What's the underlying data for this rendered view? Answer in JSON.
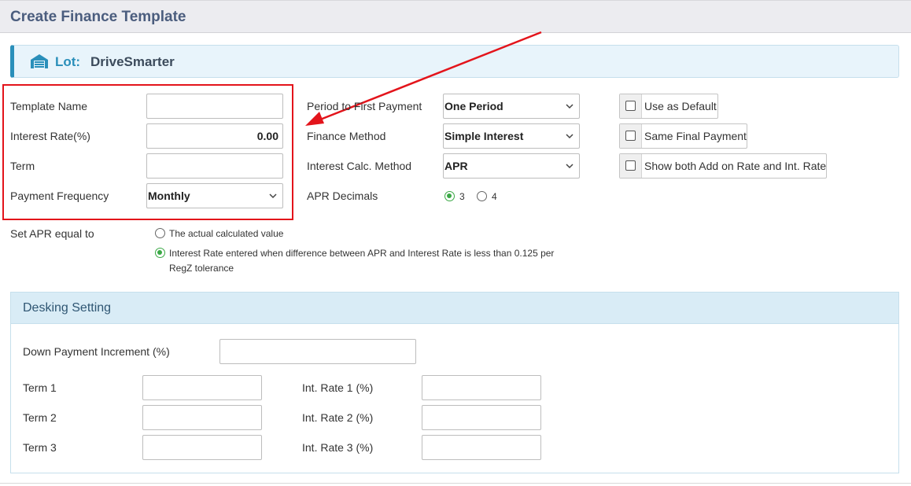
{
  "header": {
    "title": "Create Finance Template"
  },
  "lot": {
    "icon": "garage-icon",
    "label": "Lot:",
    "value": "DriveSmarter"
  },
  "left_fields": {
    "template_name": {
      "label": "Template Name",
      "value": ""
    },
    "interest_rate": {
      "label": "Interest Rate(%)",
      "value": "0.00"
    },
    "term": {
      "label": "Term",
      "value": ""
    },
    "payment_frequency": {
      "label": "Payment Frequency",
      "value": "Monthly"
    }
  },
  "middle_fields": {
    "period_first_payment": {
      "label": "Period to First Payment",
      "value": "One Period"
    },
    "finance_method": {
      "label": "Finance Method",
      "value": "Simple Interest"
    },
    "interest_calc_method": {
      "label": "Interest Calc. Method",
      "value": "APR"
    },
    "apr_decimals": {
      "label": "APR Decimals",
      "options": [
        "3",
        "4"
      ],
      "selected": "3"
    }
  },
  "checkboxes": {
    "use_default": {
      "label": "Use as Default",
      "checked": false
    },
    "same_final": {
      "label": "Same Final Payment",
      "checked": false
    },
    "show_both": {
      "label": "Show both Add on Rate and Int. Rate",
      "checked": false
    }
  },
  "set_apr": {
    "label": "Set APR equal to",
    "option1": "The actual calculated value",
    "option2_line1": "Interest Rate entered when difference between APR and Interest Rate is less than 0.125 per",
    "option2_line2": "RegZ tolerance",
    "selected": 2
  },
  "desking": {
    "title": "Desking Setting",
    "down_payment": {
      "label": "Down Payment Increment (%)",
      "value": ""
    },
    "terms": [
      {
        "label": "Term 1",
        "value": ""
      },
      {
        "label": "Term 2",
        "value": ""
      },
      {
        "label": "Term 3",
        "value": ""
      }
    ],
    "rates": [
      {
        "label": "Int. Rate 1 (%)",
        "value": ""
      },
      {
        "label": "Int. Rate 2 (%)",
        "value": ""
      },
      {
        "label": "Int. Rate 3 (%)",
        "value": ""
      }
    ]
  },
  "colors": {
    "accent": "#2a8fba",
    "highlight": "#e3141b",
    "radio_on": "#3aa845",
    "header_text": "#4b5d7e"
  }
}
